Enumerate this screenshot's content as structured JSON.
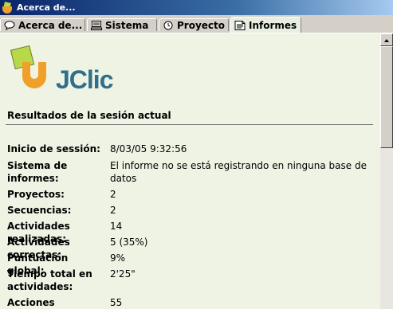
{
  "window": {
    "title": "Acerca de..."
  },
  "tabs": [
    {
      "label": "Acerca de...",
      "icon": "speech-bubble-icon"
    },
    {
      "label": "Sistema",
      "icon": "computer-icon"
    },
    {
      "label": "Proyecto",
      "icon": "clock-icon"
    },
    {
      "label": "Informes",
      "icon": "report-icon",
      "active": true
    }
  ],
  "logo": {
    "text": "JClic"
  },
  "section": {
    "title": "Resultados de la sesión actual"
  },
  "rows": [
    {
      "label": "Inicio de sessión:",
      "value": "8/03/05 9:32:56"
    },
    {
      "label": "Sistema de informes:",
      "value": "El informe no se está registrando en ninguna base de datos"
    },
    {
      "label": "Proyectos:",
      "value": "2"
    },
    {
      "label": "Secuencias:",
      "value": "2"
    },
    {
      "label": "Actividades realizadas:",
      "value": "14"
    },
    {
      "label": "Actividades correctas:",
      "value": "5 (35%)"
    },
    {
      "label": "Puntuación global:",
      "value": "9%"
    },
    {
      "label": "Tiempo total en actividades:",
      "value": "2'25\""
    },
    {
      "label": "Acciones efectuadas:",
      "value": "55"
    }
  ],
  "colors": {
    "accent": "#2f6f8c",
    "logo_green": "#b8d84a",
    "logo_orange": "#f0a028",
    "panel_bg": "#eef3e4"
  }
}
